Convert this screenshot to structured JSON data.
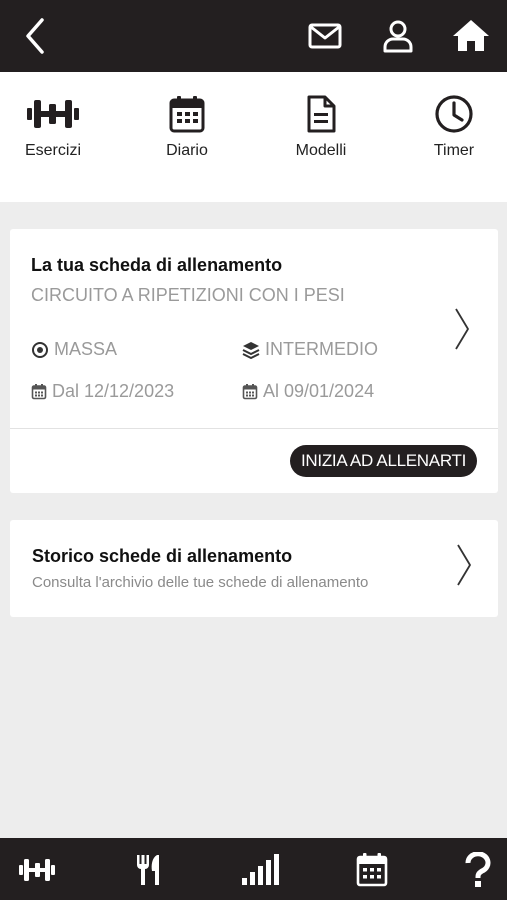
{
  "topbar": {
    "back_icon": "chevron-left-icon",
    "icons": [
      "mail-icon",
      "user-icon",
      "home-icon"
    ]
  },
  "quicknav": {
    "items": [
      {
        "label": "Esercizi",
        "icon": "dumbbell-icon"
      },
      {
        "label": "Diario",
        "icon": "calendar-icon"
      },
      {
        "label": "Modelli",
        "icon": "document-icon"
      },
      {
        "label": "Timer",
        "icon": "clock-icon"
      }
    ]
  },
  "workout_card": {
    "title": "La tua scheda di allenamento",
    "subtitle": "CIRCUITO A RIPETIZIONI CON I PESI",
    "goal": "MASSA",
    "level": "INTERMEDIO",
    "start_date": "Dal 12/12/2023",
    "end_date": "Al 09/01/2024",
    "start_button": "INIZIA AD ALLENARTI"
  },
  "history_card": {
    "title": "Storico schede di allenamento",
    "subtitle": "Consulta l'archivio delle tue schede di allenamento"
  },
  "bottombar": {
    "icons": [
      "dumbbell-icon",
      "fork-knife-icon",
      "signal-bars-icon",
      "calendar-icon",
      "help-icon"
    ]
  },
  "colors": {
    "dark": "#231f20",
    "background": "#ededed",
    "muted_text": "#9a9a9a"
  }
}
